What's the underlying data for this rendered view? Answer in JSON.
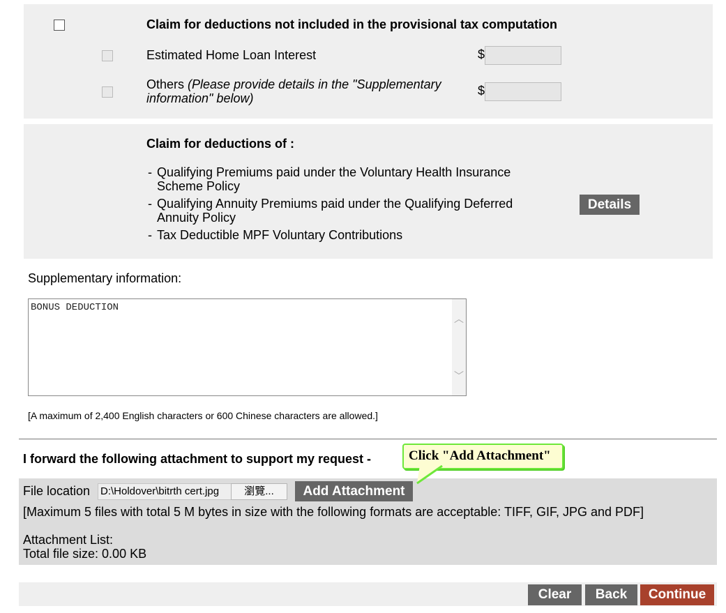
{
  "deductions_not_included": {
    "heading": "Claim for deductions not included in the provisional tax computation",
    "items": [
      {
        "label": "Estimated Home Loan Interest",
        "currency": "$",
        "value": ""
      },
      {
        "label_prefix": "Others ",
        "label_italic": "(Please provide details in the \"Supplementary",
        "label_italic_line2": "information\" below)",
        "currency": "$",
        "value": ""
      }
    ]
  },
  "deductions_of": {
    "heading": "Claim for deductions of :",
    "items": [
      {
        "line1": "Qualifying Premiums paid under the Voluntary Health Insurance",
        "line2": "Scheme Policy"
      },
      {
        "line1": "Qualifying Annuity Premiums paid under the Qualifying Deferred",
        "line2": "Annuity Policy"
      },
      {
        "line1": "Tax Deductible MPF Voluntary Contributions"
      }
    ],
    "bullet": "-",
    "details_button": "Details"
  },
  "supplementary": {
    "label": "Supplementary information:",
    "value": "BONUS DEDUCTION",
    "note": "[A maximum of 2,400 English characters or 600 Chinese characters are allowed.]"
  },
  "attachment": {
    "heading": "I forward the following attachment to support my request -",
    "file_location_label": "File location",
    "file_path": "D:\\Holdover\\bitrth cert.jpg",
    "browse_label": "瀏覽...",
    "add_button": "Add Attachment",
    "limits_note": "[Maximum 5 files with total 5 M bytes in size with the following formats are acceptable: TIFF, GIF, JPG and PDF]",
    "list_label": "Attachment List:",
    "total_size": "Total file size: 0.00 KB"
  },
  "callout": {
    "text": "Click \"Add Attachment\"",
    "fill": "#fdfdd2",
    "border": "#6ee83a"
  },
  "footer": {
    "clear": "Clear",
    "back": "Back",
    "continue": "Continue",
    "continue_color": "#a8412c",
    "button_color": "#666666"
  },
  "scrollbar": {
    "up": "︿",
    "down": "﹀"
  }
}
